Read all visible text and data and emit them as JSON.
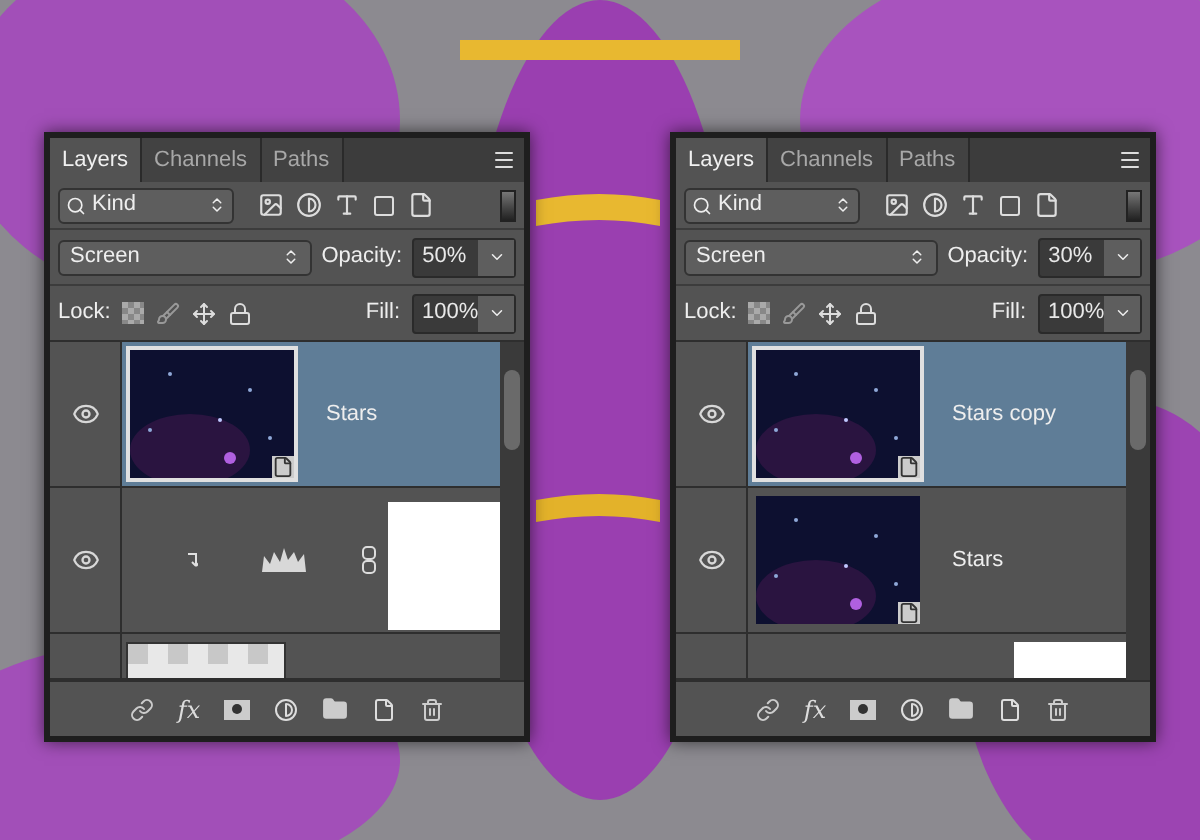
{
  "panels": [
    {
      "tabs": [
        {
          "label": "Layers",
          "selected": true
        },
        {
          "label": "Channels",
          "selected": false
        },
        {
          "label": "Paths",
          "selected": false
        }
      ],
      "filter": {
        "value": "Kind"
      },
      "blend_mode": "Screen",
      "opacity_label": "Opacity:",
      "opacity": "50%",
      "lock_label": "Lock:",
      "fill_label": "Fill:",
      "fill": "100%",
      "layers": [
        {
          "kind": "smart",
          "name": "Stars",
          "selected": true,
          "visible": true
        },
        {
          "kind": "adjustment",
          "selected": false,
          "visible": true
        },
        {
          "kind": "pixel",
          "selected": false
        }
      ],
      "footer": {
        "fx": "fx"
      }
    },
    {
      "tabs": [
        {
          "label": "Layers",
          "selected": true
        },
        {
          "label": "Channels",
          "selected": false
        },
        {
          "label": "Paths",
          "selected": false
        }
      ],
      "filter": {
        "value": "Kind"
      },
      "blend_mode": "Screen",
      "opacity_label": "Opacity:",
      "opacity": "30%",
      "lock_label": "Lock:",
      "fill_label": "Fill:",
      "fill": "100%",
      "layers": [
        {
          "kind": "smart",
          "name": "Stars copy",
          "selected": true,
          "visible": true
        },
        {
          "kind": "smart",
          "name": "Stars",
          "selected": false,
          "visible": true
        },
        {
          "kind": "adjustment",
          "selected": false
        }
      ],
      "footer": {
        "fx": "fx"
      }
    }
  ]
}
